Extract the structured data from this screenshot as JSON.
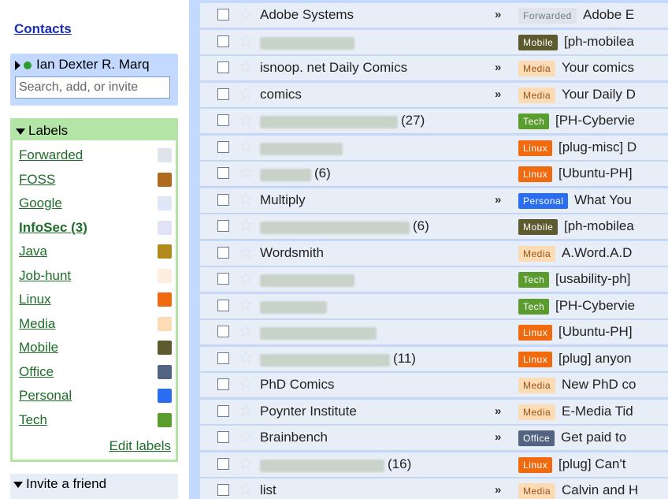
{
  "sidebar": {
    "contacts_link": "Contacts",
    "current_user": "Ian Dexter R. Marq",
    "search_placeholder": "Search, add, or invite",
    "labels_title": "Labels",
    "labels": [
      {
        "name": "Forwarded",
        "color": "#dfe4ec",
        "bold": false
      },
      {
        "name": "FOSS",
        "color": "#b06a1f",
        "bold": false
      },
      {
        "name": "Google",
        "color": "#dfe8f7",
        "bold": false
      },
      {
        "name": "InfoSec (3)",
        "color": "#e2e2f7",
        "bold": true
      },
      {
        "name": "Java",
        "color": "#b08a1a",
        "bold": false
      },
      {
        "name": "Job-hunt",
        "color": "#fdeee0",
        "bold": false
      },
      {
        "name": "Linux",
        "color": "#f06a0f",
        "bold": false
      },
      {
        "name": "Media",
        "color": "#fbdcb5",
        "bold": false
      },
      {
        "name": "Mobile",
        "color": "#5c5a2e",
        "bold": false
      },
      {
        "name": "Office",
        "color": "#536480",
        "bold": false
      },
      {
        "name": "Personal",
        "color": "#2a6df0",
        "bold": false
      },
      {
        "name": "Tech",
        "color": "#5a9c2e",
        "bold": false
      }
    ],
    "edit_labels": "Edit labels",
    "invite_title": "Invite a friend"
  },
  "mail": {
    "rows": [
      {
        "sender": "Adobe Systems",
        "count": "",
        "chevron": true,
        "label": "Forwarded",
        "label_bg": "#dfe4ec",
        "label_fg": "#6b7a8c",
        "subject": "Adobe E"
      },
      {
        "sender": "",
        "count": "",
        "chevron": false,
        "label": "Mobile",
        "label_bg": "#5c5a2e",
        "label_fg": "#ffffff",
        "subject": "[ph-mobilea"
      },
      {
        "sender": "isnoop. net Daily Comics",
        "count": "",
        "chevron": true,
        "label": "Media",
        "label_bg": "#fbdcb5",
        "label_fg": "#a0521a",
        "subject": "Your comics"
      },
      {
        "sender": "comics",
        "count": "",
        "chevron": true,
        "label": "Media",
        "label_bg": "#fbdcb5",
        "label_fg": "#a0521a",
        "subject": "Your Daily D"
      },
      {
        "sender": "",
        "count": "(27)",
        "chevron": false,
        "label": "Tech",
        "label_bg": "#5a9c2e",
        "label_fg": "#ffffff",
        "subject": "[PH-Cybervie"
      },
      {
        "sender": "",
        "count": "",
        "chevron": false,
        "label": "Linux",
        "label_bg": "#f06a0f",
        "label_fg": "#ffffff",
        "subject": "[plug-misc] D"
      },
      {
        "sender": "",
        "count": "(6)",
        "chevron": false,
        "label": "Linux",
        "label_bg": "#f06a0f",
        "label_fg": "#ffffff",
        "subject": "[Ubuntu-PH]"
      },
      {
        "sender": "Multiply",
        "count": "",
        "chevron": true,
        "label": "Personal",
        "label_bg": "#2a6df0",
        "label_fg": "#ffffff",
        "subject": "What You"
      },
      {
        "sender": "",
        "count": "(6)",
        "chevron": false,
        "label": "Mobile",
        "label_bg": "#5c5a2e",
        "label_fg": "#ffffff",
        "subject": "[ph-mobilea"
      },
      {
        "sender": "Wordsmith",
        "count": "",
        "chevron": false,
        "label": "Media",
        "label_bg": "#fbdcb5",
        "label_fg": "#a0521a",
        "subject": "A.Word.A.D"
      },
      {
        "sender": "",
        "count": "",
        "chevron": false,
        "label": "Tech",
        "label_bg": "#5a9c2e",
        "label_fg": "#ffffff",
        "subject": "[usability-ph]"
      },
      {
        "sender": "",
        "count": "",
        "chevron": false,
        "label": "Tech",
        "label_bg": "#5a9c2e",
        "label_fg": "#ffffff",
        "subject": "[PH-Cybervie"
      },
      {
        "sender": "",
        "count": "",
        "chevron": false,
        "label": "Linux",
        "label_bg": "#f06a0f",
        "label_fg": "#ffffff",
        "subject": "[Ubuntu-PH]"
      },
      {
        "sender": "",
        "count": "(11)",
        "chevron": false,
        "label": "Linux",
        "label_bg": "#f06a0f",
        "label_fg": "#ffffff",
        "subject": "[plug] anyon"
      },
      {
        "sender": "PhD Comics",
        "count": "",
        "chevron": false,
        "label": "Media",
        "label_bg": "#fbdcb5",
        "label_fg": "#a0521a",
        "subject": "New PhD co"
      },
      {
        "sender": "Poynter Institute",
        "count": "",
        "chevron": true,
        "label": "Media",
        "label_bg": "#fbdcb5",
        "label_fg": "#a0521a",
        "subject": "E-Media Tid"
      },
      {
        "sender": "Brainbench",
        "count": "",
        "chevron": true,
        "label": "Office",
        "label_bg": "#536480",
        "label_fg": "#ffffff",
        "subject": "Get paid to"
      },
      {
        "sender": "",
        "count": "(16)",
        "chevron": false,
        "label": "Linux",
        "label_bg": "#f06a0f",
        "label_fg": "#ffffff",
        "subject": "[plug] Can't"
      },
      {
        "sender": "list",
        "count": "",
        "chevron": true,
        "label": "Media",
        "label_bg": "#fbdcb5",
        "label_fg": "#a0521a",
        "subject": "Calvin and H"
      }
    ]
  }
}
